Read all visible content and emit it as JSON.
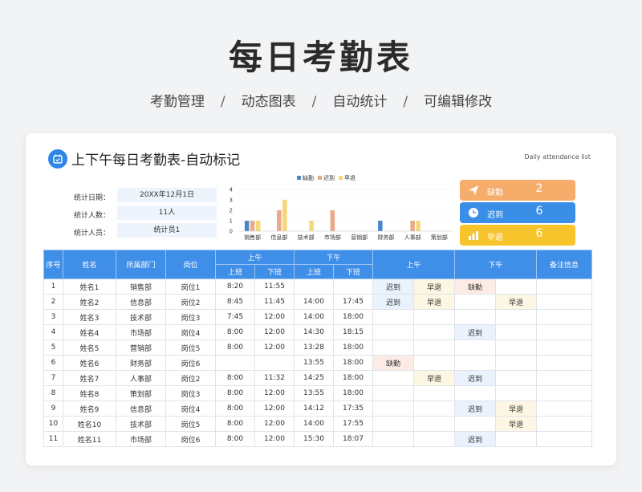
{
  "hero": {
    "title": "每日考勤表",
    "features": [
      "考勤管理",
      "动态图表",
      "自动统计",
      "可编辑修改"
    ],
    "separator": "/"
  },
  "card": {
    "title": "上下午每日考勤表-自动标记",
    "subtitle_en": "Daily attendance list"
  },
  "info": {
    "date_label": "统计日期：",
    "date_value": "20XX年12月1日",
    "count_label": "统计人数：",
    "count_value": "11人",
    "person_label": "统计人员：",
    "person_value": "统计员1"
  },
  "chart_data": {
    "type": "bar",
    "categories": [
      "销售部",
      "信息部",
      "技术部",
      "市场部",
      "营销部",
      "财务部",
      "人事部",
      "策划部"
    ],
    "series": [
      {
        "name": "缺勤",
        "color": "#4a86c6",
        "values": [
          1,
          0,
          0,
          0,
          0,
          1,
          0,
          0
        ]
      },
      {
        "name": "迟到",
        "color": "#eaa989",
        "values": [
          1,
          2,
          0,
          2,
          0,
          0,
          1,
          0
        ]
      },
      {
        "name": "早退",
        "color": "#f6d777",
        "values": [
          1,
          3,
          1,
          0,
          0,
          0,
          1,
          0
        ]
      }
    ],
    "ylim": [
      0,
      4
    ],
    "yticks": [
      "0",
      "1",
      "2",
      "3",
      "4"
    ],
    "legend": "top"
  },
  "stats": [
    {
      "label": "缺勤",
      "value": "2",
      "color": "#f6ad6c",
      "icon": "paper-plane-icon"
    },
    {
      "label": "迟到",
      "value": "6",
      "color": "#3a8ee6",
      "icon": "clock-icon"
    },
    {
      "label": "早退",
      "value": "6",
      "color": "#f8c42c",
      "icon": "bar-chart-icon"
    }
  ],
  "table": {
    "headers": {
      "no": "序号",
      "name": "姓名",
      "dept": "所属部门",
      "post": "岗位",
      "am": "上午",
      "pm": "下午",
      "on": "上班",
      "off": "下班",
      "am_mark": "上午",
      "pm_mark": "下午",
      "note": "备注信息"
    },
    "rows": [
      {
        "no": "1",
        "name": "姓名1",
        "dept": "销售部",
        "post": "岗位1",
        "am_in": "8:20",
        "am_out": "11:55",
        "pm_in": "",
        "pm_out": "",
        "am_late": "迟到",
        "am_early": "早退",
        "pm_late": "缺勤",
        "pm_early": "",
        "note": ""
      },
      {
        "no": "2",
        "name": "姓名2",
        "dept": "信息部",
        "post": "岗位2",
        "am_in": "8:45",
        "am_out": "11:45",
        "pm_in": "14:00",
        "pm_out": "17:45",
        "am_late": "迟到",
        "am_early": "早退",
        "pm_late": "",
        "pm_early": "早退",
        "note": ""
      },
      {
        "no": "3",
        "name": "姓名3",
        "dept": "技术部",
        "post": "岗位3",
        "am_in": "7:45",
        "am_out": "12:00",
        "pm_in": "14:00",
        "pm_out": "18:00",
        "am_late": "",
        "am_early": "",
        "pm_late": "",
        "pm_early": "",
        "note": ""
      },
      {
        "no": "4",
        "name": "姓名4",
        "dept": "市场部",
        "post": "岗位4",
        "am_in": "8:00",
        "am_out": "12:00",
        "pm_in": "14:30",
        "pm_out": "18:15",
        "am_late": "",
        "am_early": "",
        "pm_late": "迟到",
        "pm_early": "",
        "note": ""
      },
      {
        "no": "5",
        "name": "姓名5",
        "dept": "营销部",
        "post": "岗位5",
        "am_in": "8:00",
        "am_out": "12:00",
        "pm_in": "13:28",
        "pm_out": "18:00",
        "am_late": "",
        "am_early": "",
        "pm_late": "",
        "pm_early": "",
        "note": ""
      },
      {
        "no": "6",
        "name": "姓名6",
        "dept": "财务部",
        "post": "岗位6",
        "am_in": "",
        "am_out": "",
        "pm_in": "13:55",
        "pm_out": "18:00",
        "am_late": "缺勤",
        "am_early": "",
        "pm_late": "",
        "pm_early": "",
        "note": ""
      },
      {
        "no": "7",
        "name": "姓名7",
        "dept": "人事部",
        "post": "岗位2",
        "am_in": "8:00",
        "am_out": "11:32",
        "pm_in": "14:25",
        "pm_out": "18:00",
        "am_late": "",
        "am_early": "早退",
        "pm_late": "迟到",
        "pm_early": "",
        "note": ""
      },
      {
        "no": "8",
        "name": "姓名8",
        "dept": "策划部",
        "post": "岗位3",
        "am_in": "8:00",
        "am_out": "12:00",
        "pm_in": "13:55",
        "pm_out": "18:00",
        "am_late": "",
        "am_early": "",
        "pm_late": "",
        "pm_early": "",
        "note": ""
      },
      {
        "no": "9",
        "name": "姓名9",
        "dept": "信息部",
        "post": "岗位4",
        "am_in": "8:00",
        "am_out": "12:00",
        "pm_in": "14:12",
        "pm_out": "17:35",
        "am_late": "",
        "am_early": "",
        "pm_late": "迟到",
        "pm_early": "早退",
        "note": ""
      },
      {
        "no": "10",
        "name": "姓名10",
        "dept": "技术部",
        "post": "岗位5",
        "am_in": "8:00",
        "am_out": "12:00",
        "pm_in": "14:00",
        "pm_out": "17:55",
        "am_late": "",
        "am_early": "",
        "pm_late": "",
        "pm_early": "早退",
        "note": ""
      },
      {
        "no": "11",
        "name": "姓名11",
        "dept": "市场部",
        "post": "岗位6",
        "am_in": "8:00",
        "am_out": "12:00",
        "pm_in": "15:30",
        "pm_out": "18:07",
        "am_late": "",
        "am_early": "",
        "pm_late": "迟到",
        "pm_early": "",
        "note": ""
      }
    ]
  }
}
